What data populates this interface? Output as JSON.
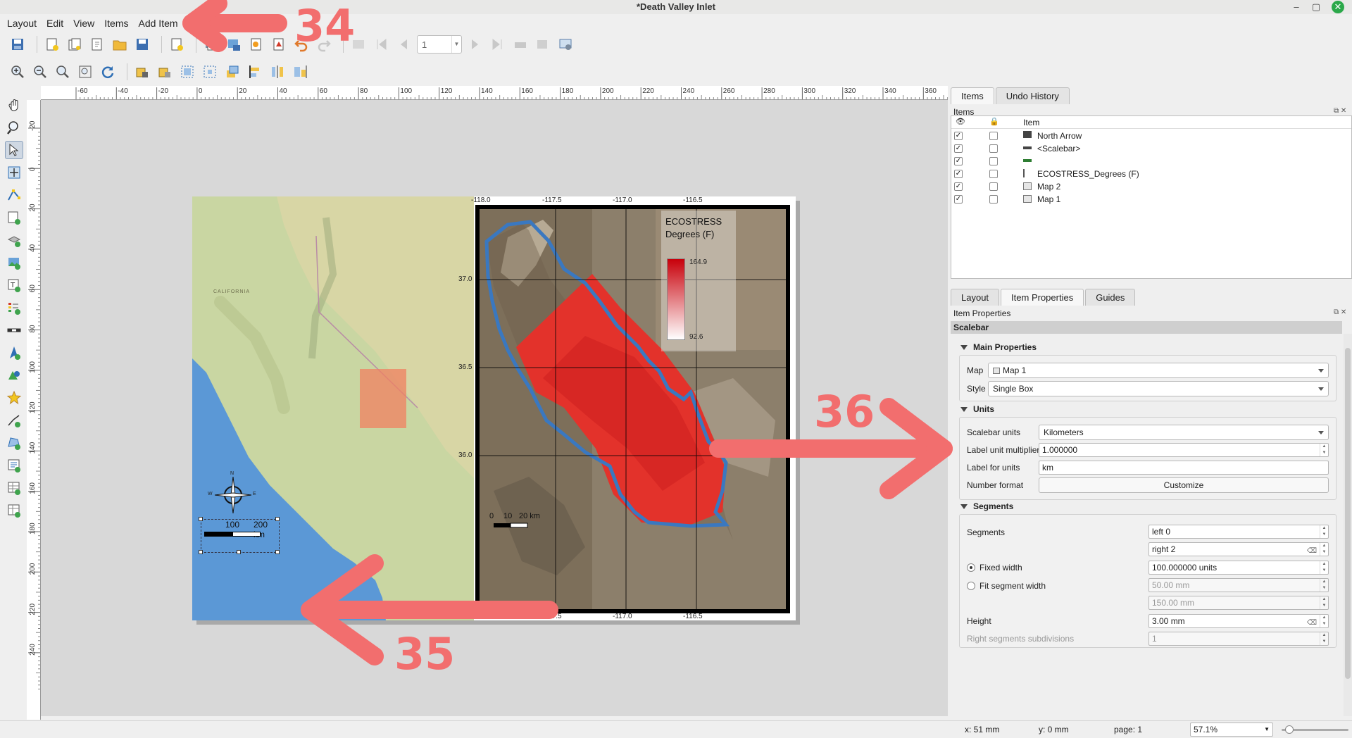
{
  "window": {
    "title": "*Death Valley Inlet",
    "minimize": "–",
    "maximize": "▢",
    "close": "✕"
  },
  "menu": [
    "Layout",
    "Edit",
    "View",
    "Items",
    "Add Item"
  ],
  "toolbar": {
    "page_number": "1"
  },
  "ruler": {
    "h_ticks": [
      "-60",
      "-40",
      "-20",
      "0",
      "20",
      "40",
      "60",
      "80",
      "100",
      "120",
      "140",
      "160",
      "180",
      "200",
      "220",
      "240",
      "260",
      "280",
      "300",
      "320",
      "340",
      "360"
    ],
    "v_ticks": [
      "-20",
      "0",
      "20",
      "40",
      "60",
      "80",
      "100",
      "120",
      "140",
      "160",
      "180",
      "200",
      "220",
      "240"
    ]
  },
  "layout_page": {
    "map1_graticule": {
      "top": [
        "-118.0",
        "-117.5",
        "-117.0",
        "-116.5"
      ],
      "bottom": [
        "-117.5",
        "-117.0",
        "-116.5"
      ],
      "left": [
        "37.0",
        "36.5",
        "36.0"
      ]
    },
    "legend": {
      "title_line1": "ECOSTRESS",
      "title_line2": "Degrees (F)",
      "max": "164.9",
      "min": "92.6"
    },
    "map1_scalebar": {
      "zero": "0",
      "mid": "10",
      "end": "20 km"
    },
    "map2_scalebar": {
      "mid": "100",
      "end": "200 km"
    },
    "map2_state_label": "CALIFORNIA",
    "north_arrow": {
      "n": "N",
      "s": "S",
      "e": "E",
      "w": "W"
    }
  },
  "annotations": {
    "a34": "34",
    "a35": "35",
    "a36": "36"
  },
  "items_panel": {
    "tabs": [
      "Items",
      "Undo History"
    ],
    "caption": "Items",
    "header_item": "Item",
    "rows": [
      {
        "name": "North Arrow",
        "visible": true,
        "locked": false
      },
      {
        "name": "<Scalebar>",
        "visible": true,
        "locked": false
      },
      {
        "name": "",
        "visible": true,
        "locked": false
      },
      {
        "name": "ECOSTRESS_Degrees (F)",
        "visible": true,
        "locked": false
      },
      {
        "name": "Map 2",
        "visible": true,
        "locked": false
      },
      {
        "name": "Map 1",
        "visible": true,
        "locked": false
      }
    ],
    "check": "✓"
  },
  "props_panel": {
    "tabs": [
      "Layout",
      "Item Properties",
      "Guides"
    ],
    "caption": "Item Properties",
    "section": "Scalebar",
    "main": {
      "title": "Main Properties",
      "map_label": "Map",
      "map_value": "Map 1",
      "style_label": "Style",
      "style_value": "Single Box"
    },
    "units": {
      "title": "Units",
      "scalebar_units_label": "Scalebar units",
      "scalebar_units_value": "Kilometers",
      "multiplier_label": "Label unit multiplier",
      "multiplier_value": "1.000000",
      "label_for_units_label": "Label for units",
      "label_for_units_value": "km",
      "number_format_label": "Number format",
      "customize_button": "Customize"
    },
    "segments": {
      "title": "Segments",
      "segments_label": "Segments",
      "left_value": "left 0",
      "right_value": "right 2",
      "fixed_width_label": "Fixed width",
      "fixed_width_value": "100.000000 units",
      "fit_width_label": "Fit segment width",
      "fit_min": "50.00 mm",
      "fit_max": "150.00 mm",
      "height_label": "Height",
      "height_value": "3.00 mm",
      "subdiv_label": "Right segments subdivisions",
      "subdiv_value": "1"
    }
  },
  "status": {
    "x": "x: 51 mm",
    "y": "y: 0 mm",
    "page": "page: 1",
    "zoom": "57.1%"
  },
  "colors": {
    "accent_annotation": "#f26e6e",
    "heat_max": "#c8000a",
    "heat_min": "#ffffff",
    "boundary": "#3a78c0"
  }
}
